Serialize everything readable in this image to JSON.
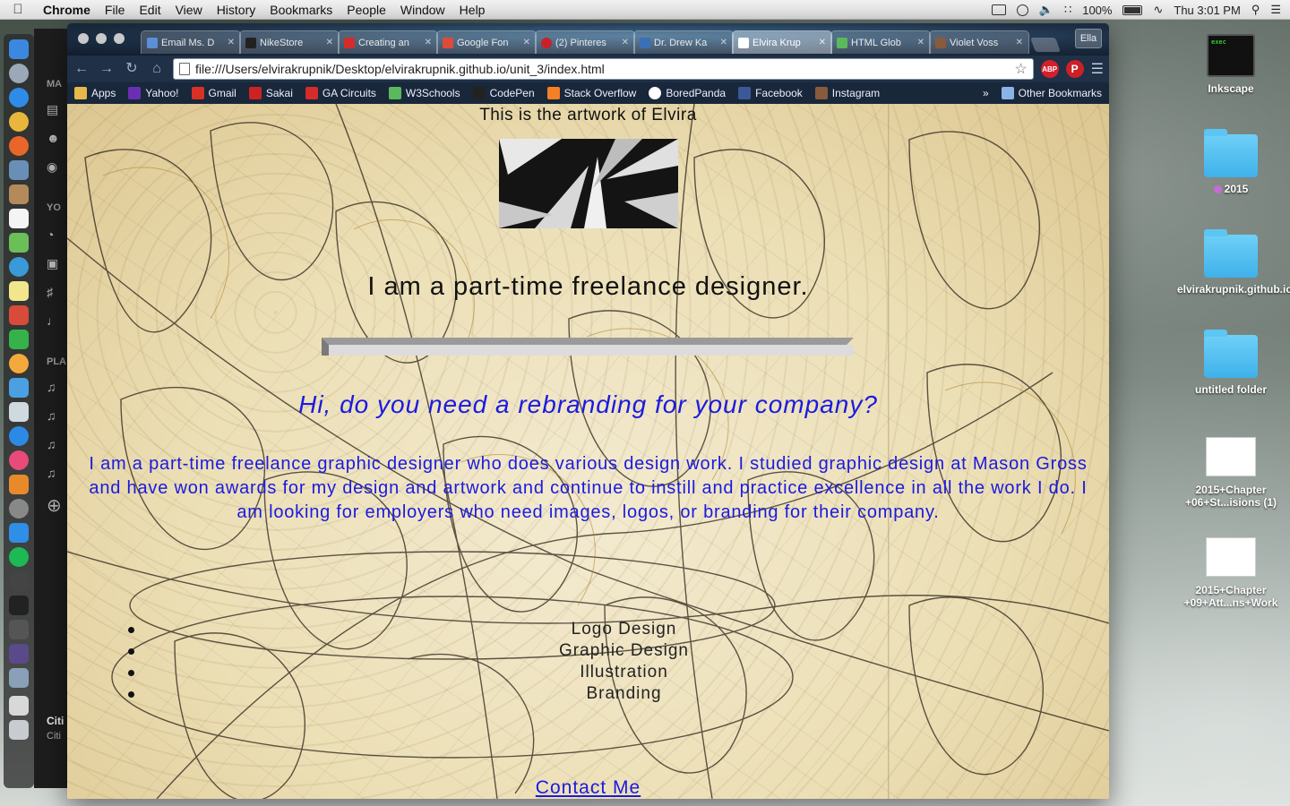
{
  "menubar": {
    "app_name": "Chrome",
    "items": [
      "File",
      "Edit",
      "View",
      "History",
      "Bookmarks",
      "People",
      "Window",
      "Help"
    ],
    "battery": "100%",
    "clock": "Thu 3:01 PM"
  },
  "spotify": {
    "section_1": "MA",
    "section_2": "YO",
    "section_3": "PLA",
    "now_playing_1": "Citi",
    "now_playing_2": "Citi"
  },
  "desktop": {
    "icons": [
      {
        "label": "Inkscape",
        "kind": "terminal",
        "thumb_text": "exec"
      },
      {
        "label": "2015",
        "kind": "folder",
        "tag_color": "#c86ad8"
      },
      {
        "label": "elvirakrupnik.github.io",
        "kind": "folder"
      },
      {
        "label": "untitled folder",
        "kind": "folder"
      },
      {
        "label": "2015+Chapter +06+St...isions (1)",
        "kind": "document"
      },
      {
        "label": "2015+Chapter +09+Att...ns+Work",
        "kind": "document"
      }
    ]
  },
  "browser": {
    "tabs": [
      {
        "title": "Email Ms. D",
        "favicon_color": "#5b8fd6"
      },
      {
        "title": "NikeStore",
        "favicon_color": "#222222"
      },
      {
        "title": "Creating an",
        "favicon_color": "#d62b2b"
      },
      {
        "title": "Google Fon",
        "favicon_color": "#e04a3a"
      },
      {
        "title": "(2) Pinteres",
        "favicon_color": "#cb2027"
      },
      {
        "title": "Dr. Drew Ka",
        "favicon_color": "#3b6fb6"
      },
      {
        "title": "Elvira Krup",
        "favicon_color": "#ffffff",
        "active": true
      },
      {
        "title": "HTML Glob",
        "favicon_color": "#5cb85c"
      },
      {
        "title": "Violet Voss",
        "favicon_color": "#8a5a3c"
      }
    ],
    "profile_label": "Ella",
    "url": "file:///Users/elvirakrupnik/Desktop/elvirakrupnik.github.io/unit_3/index.html",
    "extensions": {
      "abp": "ABP",
      "pinterest": "P"
    },
    "bookmarks": [
      {
        "label": "Apps",
        "icon_color": "#e8b84a"
      },
      {
        "label": "Yahoo!",
        "icon_color": "#6b2fb3"
      },
      {
        "label": "Gmail",
        "icon_color": "#d93025"
      },
      {
        "label": "Sakai",
        "icon_color": "#cc2222"
      },
      {
        "label": "GA Circuits",
        "icon_color": "#d62b2b"
      },
      {
        "label": "W3Schools",
        "icon_color": "#5cb85c"
      },
      {
        "label": "CodePen",
        "icon_color": "#222222"
      },
      {
        "label": "Stack Overflow",
        "icon_color": "#f48024"
      },
      {
        "label": "BoredPanda",
        "icon_color": "#ffffff"
      },
      {
        "label": "Facebook",
        "icon_color": "#3b5998"
      },
      {
        "label": "Instagram",
        "icon_color": "#8a5a3c"
      }
    ],
    "overflow": "»",
    "other_bookmarks": "Other Bookmarks"
  },
  "page": {
    "title": "This is the artwork of Elvira",
    "tagline": "I am a part-time freelance designer.",
    "headline": "Hi, do you need a rebranding for your company?",
    "intro": "I am a part-time freelance graphic designer who does various design work. I studied graphic design at Mason Gross and have won awards for my design and artwork and continue to instill and practice excellence in all the work I do. I am looking for employers who need images, logos, or branding for their company.",
    "services": [
      "Logo Design",
      "Graphic Design",
      "Illustration",
      "Branding"
    ],
    "contact": "Contact Me",
    "text_color": "#1a1ae0"
  }
}
